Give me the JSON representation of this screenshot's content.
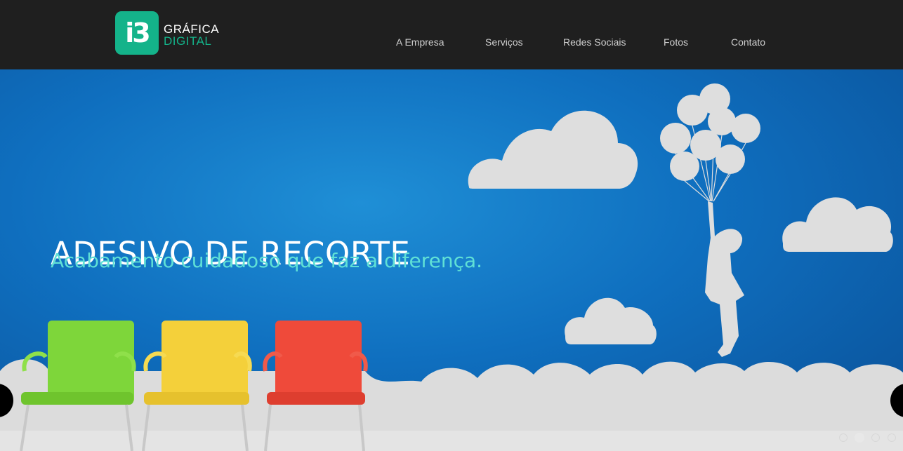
{
  "logo": {
    "mark": "i3",
    "line1": "GRÁFICA",
    "line2": "DIGITAL"
  },
  "nav": {
    "items": [
      {
        "label": "A Empresa"
      },
      {
        "label": "Serviços"
      },
      {
        "label": "Redes Sociais"
      },
      {
        "label": "Fotos"
      },
      {
        "label": "Contato"
      }
    ]
  },
  "hero": {
    "title": "ADESIVO DE RECORTE",
    "subtitle": "Acabamento cuidadoso que faz a diferença.",
    "slides": {
      "count": 4,
      "active_index": 1
    }
  },
  "colors": {
    "header_bg": "#1f1f1f",
    "brand_green": "#14b38a",
    "hero_blue": "#0f6fbf",
    "subtitle_cyan": "#5fe0d6",
    "chair_green": "#7ed63a",
    "chair_yellow": "#f4d03a",
    "chair_red": "#ef4a3a"
  },
  "icons": [
    "prev-arrow-icon",
    "next-arrow-icon",
    "cloud-icon",
    "balloons-icon",
    "chair-icon"
  ]
}
